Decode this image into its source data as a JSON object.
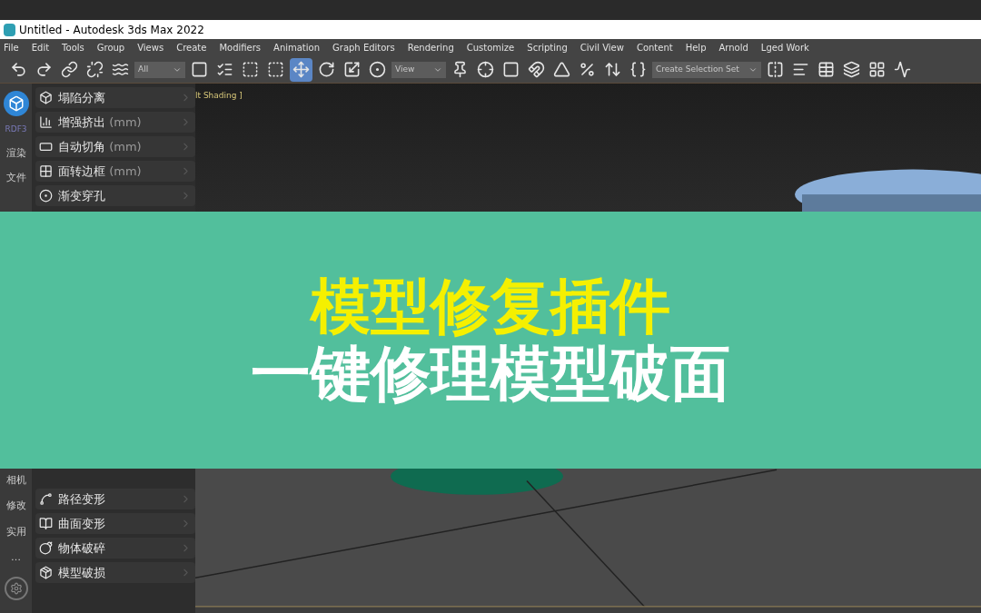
{
  "window": {
    "title": "Untitled - Autodesk 3ds Max 2022"
  },
  "menu": [
    "File",
    "Edit",
    "Tools",
    "Group",
    "Views",
    "Create",
    "Modifiers",
    "Animation",
    "Graph Editors",
    "Rendering",
    "Customize",
    "Scripting",
    "Civil View",
    "Content",
    "Help",
    "Arnold",
    "Lged Work"
  ],
  "toolbar": {
    "filter": "All",
    "coord": "View",
    "selection_set": "Create Selection Set",
    "move_selected": true
  },
  "side_strip": {
    "top_label": "RDF3",
    "labels_top": [
      "渲染",
      "文件"
    ],
    "labels_bottom": [
      "相机",
      "修改",
      "实用"
    ],
    "more": "…"
  },
  "panel": {
    "items_top": [
      {
        "label": "塌陷分离"
      },
      {
        "label": "增强挤出",
        "unit": "(mm)"
      },
      {
        "label": "自动切角",
        "unit": "(mm)"
      },
      {
        "label": "面转边框",
        "unit": "(mm)"
      },
      {
        "label": "渐变穿孔"
      }
    ],
    "items_bottom": [
      {
        "label": "路径变形"
      },
      {
        "label": "曲面变形"
      },
      {
        "label": "物体破碎"
      },
      {
        "label": "模型破损"
      }
    ]
  },
  "viewport": {
    "label": "lt Shading ]"
  },
  "banner": {
    "line1": "模型修复插件",
    "line2": "一键修理模型破面"
  }
}
